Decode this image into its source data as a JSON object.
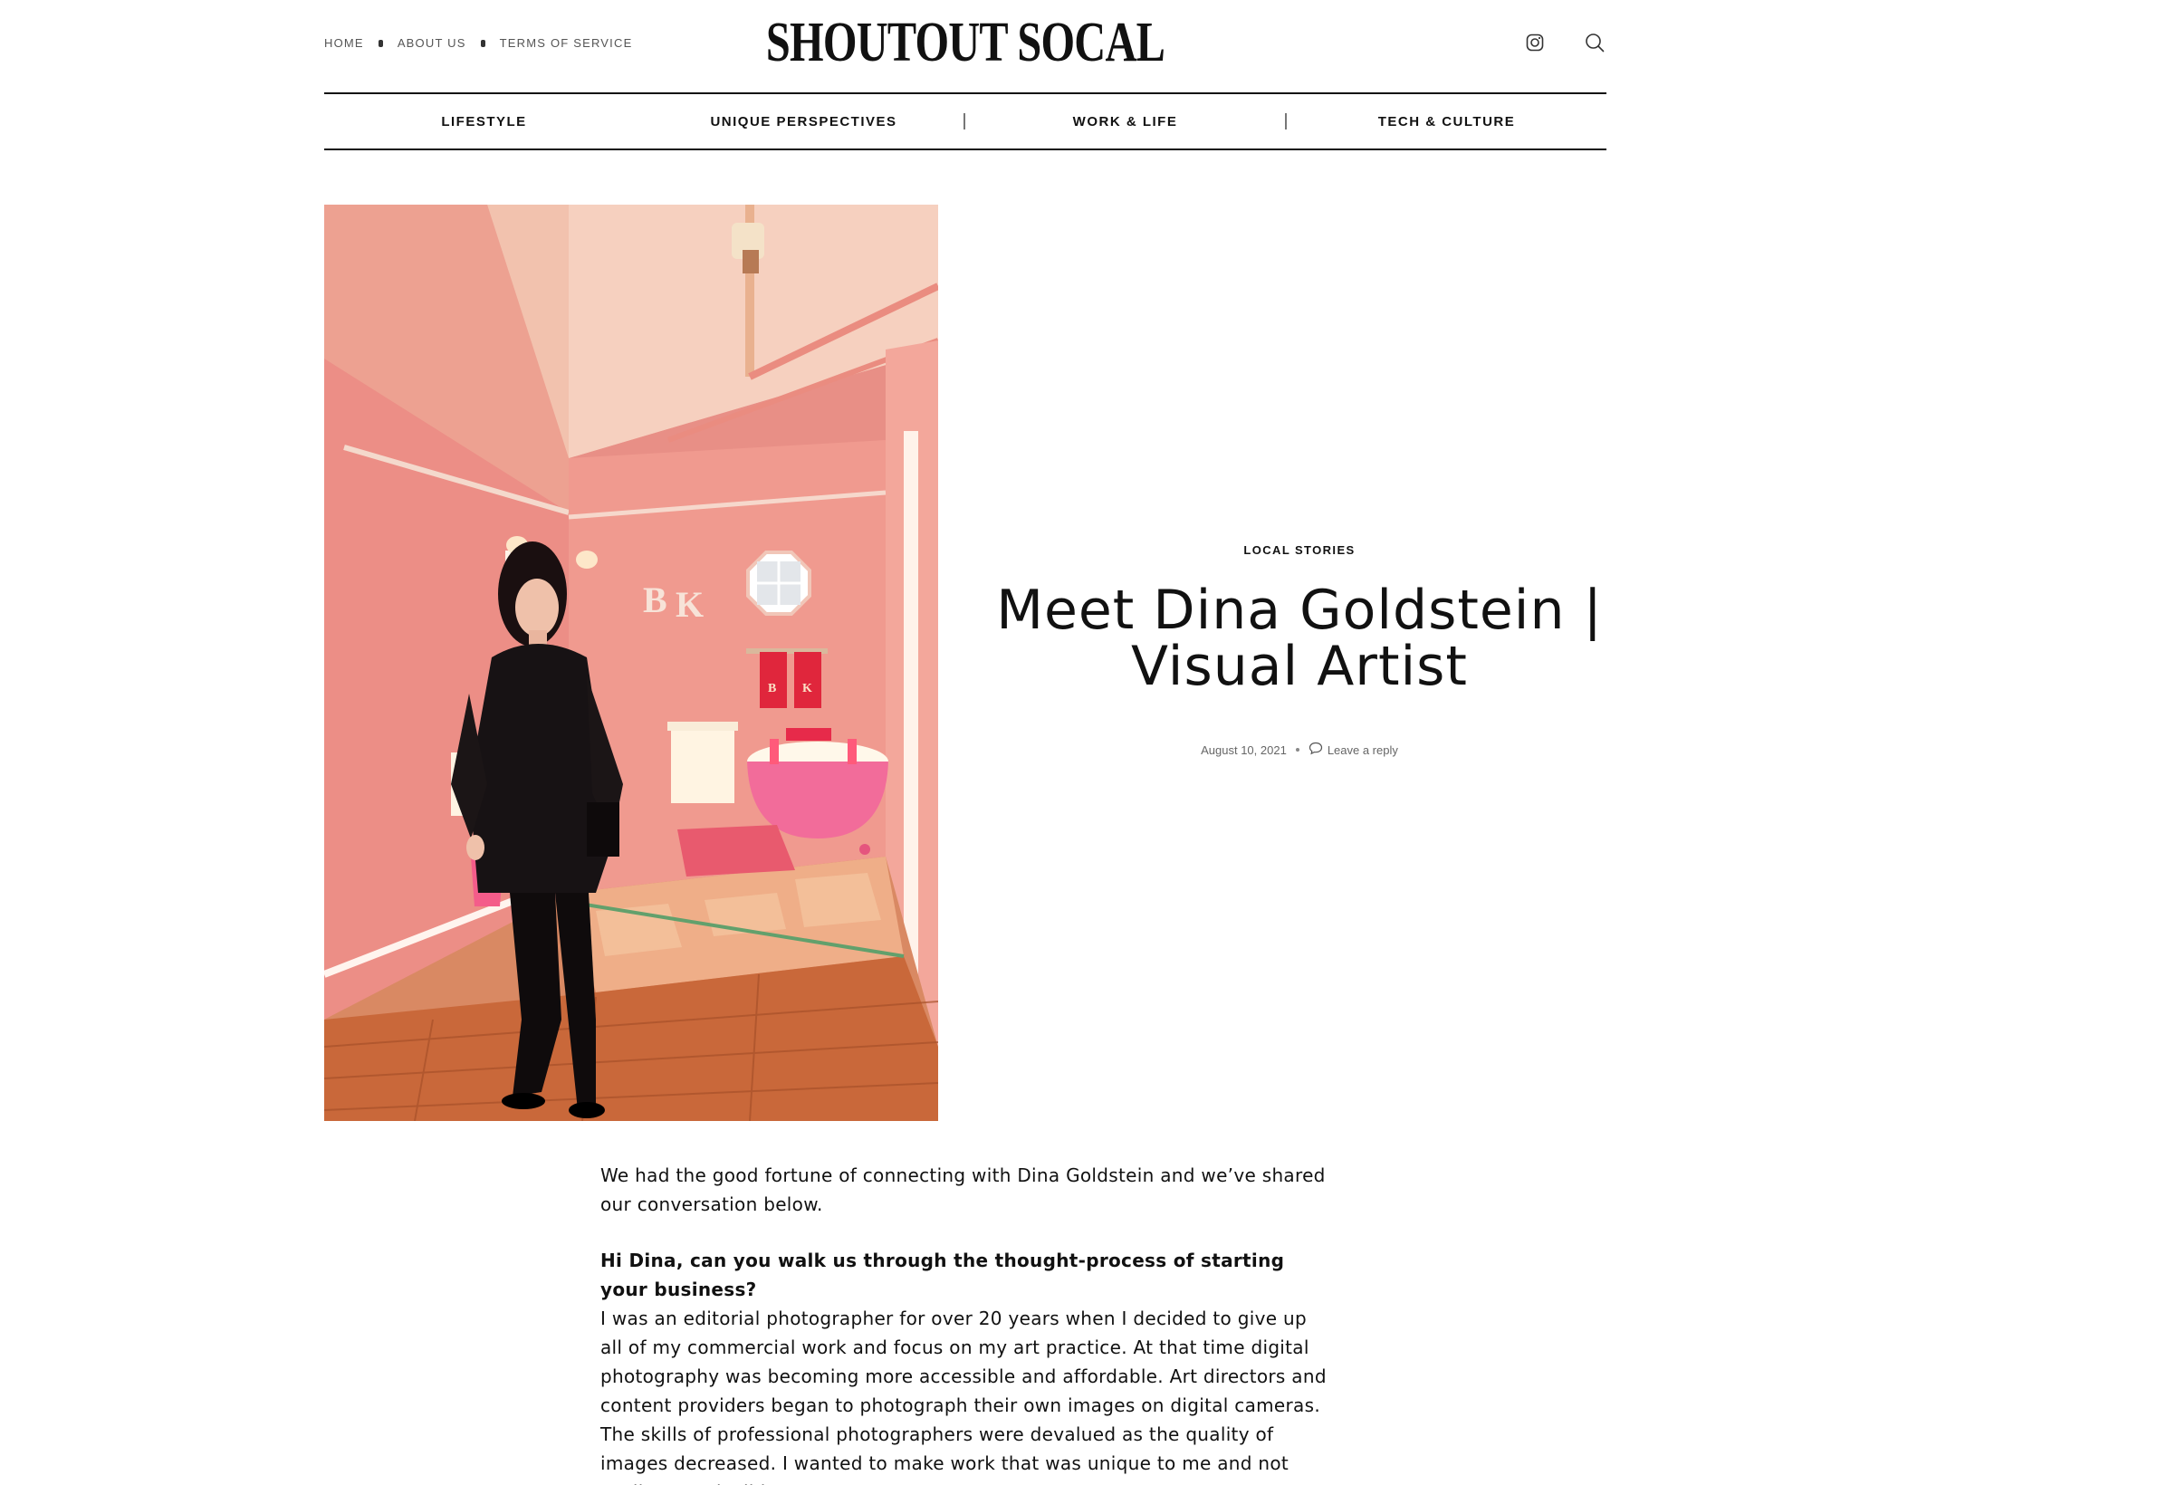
{
  "site": {
    "logo": "SHOUTOUT SOCAL",
    "top_links": [
      "HOME",
      "ABOUT US",
      "TERMS OF SERVICE"
    ]
  },
  "nav": {
    "categories": [
      "LIFESTYLE",
      "UNIQUE PERSPECTIVES",
      "WORK & LIFE",
      "TECH & CULTURE"
    ]
  },
  "icons": {
    "instagram": "instagram-icon",
    "search": "search-icon",
    "comment": "comment-bubble-icon"
  },
  "post": {
    "category": "LOCAL STORIES",
    "title_line1": "Meet Dina Goldstein |",
    "title_line2": "Visual Artist",
    "date": "August 10, 2021",
    "reply_link": "Leave a reply"
  },
  "article": {
    "intro": "We had the good fortune of connecting with Dina Goldstein and we’ve shared our conversation below.",
    "question1": "Hi Dina, can you walk us through the thought-process of starting your business?",
    "answer1": "I was an editorial photographer for over 20 years when I decided to give up all of my commercial work and focus on my art practice. At that time digital photography was becoming more accessible and affordable. Art directors and content providers began to photograph their own images on digital cameras. The skills of professional photographers were devalued as the quality of images decreased. I wanted to make work that was unique to me and not easily reproducible."
  },
  "colors": {
    "accent": "#111111",
    "muted": "#666666",
    "wall_pink": "#ec8e86",
    "floor_wood": "#c9683a"
  }
}
